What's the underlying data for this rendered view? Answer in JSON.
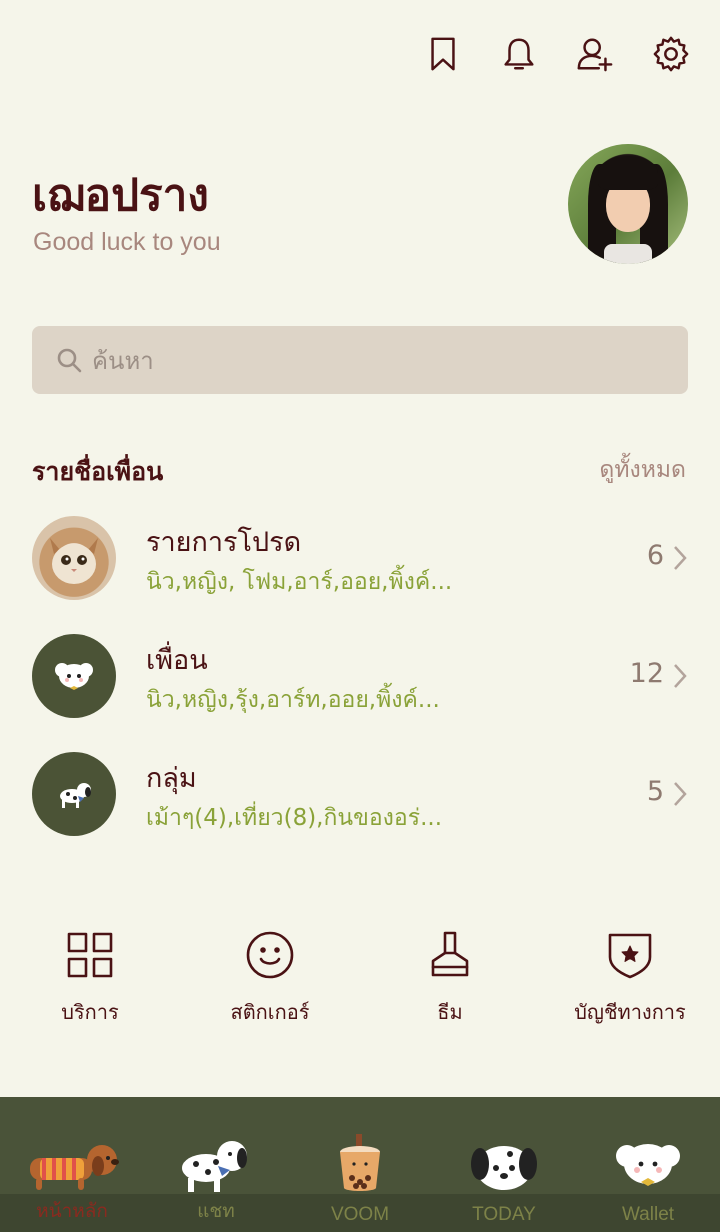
{
  "header": {
    "icons": [
      "bookmark-icon",
      "bell-icon",
      "add-friend-icon",
      "gear-icon"
    ]
  },
  "profile": {
    "name": "เฌอปราง",
    "status": "Good luck to you"
  },
  "search": {
    "placeholder": "ค้นหา"
  },
  "friends_section": {
    "title": "รายชื่อเพื่อน",
    "see_all": "ดูทั้งหมด",
    "rows": [
      {
        "title": "รายการโปรด",
        "subtitle": "นิว,หญิง, โฟม,อาร์,ออย,พิ้งค์...",
        "count": "6"
      },
      {
        "title": "เพื่อน",
        "subtitle": "นิว,หญิง,รุ้ง,อาร์ท,ออย,พิ้งค์...",
        "count": "12"
      },
      {
        "title": "กลุ่ม",
        "subtitle": "เม้าๆ(4),เที่ยว(8),กินของอร่...",
        "count": "5"
      }
    ]
  },
  "services": [
    {
      "label": "บริการ",
      "icon": "grid-icon"
    },
    {
      "label": "สติกเกอร์",
      "icon": "smiley-icon"
    },
    {
      "label": "ธีม",
      "icon": "brush-icon"
    },
    {
      "label": "บัญชีทางการ",
      "icon": "shield-star-icon"
    }
  ],
  "tabbar": [
    {
      "label": "หน้าหลัก",
      "active": true
    },
    {
      "label": "แชท",
      "active": false
    },
    {
      "label": "VOOM",
      "active": false
    },
    {
      "label": "TODAY",
      "active": false
    },
    {
      "label": "Wallet",
      "active": false
    }
  ],
  "colors": {
    "background": "#f5f5ea",
    "primary_text": "#4a1214",
    "accent_green": "#8aa238",
    "tabbar_bg": "#4a5339"
  }
}
